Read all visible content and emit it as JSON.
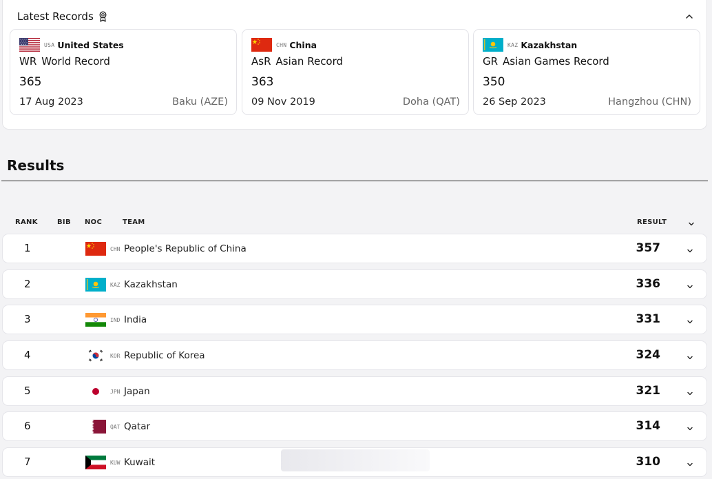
{
  "records": {
    "title": "Latest Records",
    "medal_icon": "medal-icon",
    "collapse_icon": "chevron-up-icon",
    "cards": [
      {
        "noc": "USA",
        "country": "United States",
        "abbr": "WR",
        "type": "World Record",
        "value": "365",
        "date": "17 Aug 2023",
        "venue": "Baku (AZE)",
        "flag": "usa"
      },
      {
        "noc": "CHN",
        "country": "China",
        "abbr": "AsR",
        "type": "Asian Record",
        "value": "363",
        "date": "09 Nov 2019",
        "venue": "Doha (QAT)",
        "flag": "chn"
      },
      {
        "noc": "KAZ",
        "country": "Kazakhstan",
        "abbr": "GR",
        "type": "Asian Games Record",
        "value": "350",
        "date": "26 Sep 2023",
        "venue": "Hangzhou (CHN)",
        "flag": "kaz"
      }
    ]
  },
  "results": {
    "title": "Results",
    "columns": {
      "rank": "RANK",
      "bib": "BIB",
      "noc": "NOC",
      "team": "TEAM",
      "result": "RESULT"
    },
    "rows": [
      {
        "rank": "1",
        "noc": "CHN",
        "team": "People's Republic of China",
        "result": "357",
        "flag": "chn"
      },
      {
        "rank": "2",
        "noc": "KAZ",
        "team": "Kazakhstan",
        "result": "336",
        "flag": "kaz"
      },
      {
        "rank": "3",
        "noc": "IND",
        "team": "India",
        "result": "331",
        "flag": "ind"
      },
      {
        "rank": "4",
        "noc": "KOR",
        "team": "Republic of Korea",
        "result": "324",
        "flag": "kor"
      },
      {
        "rank": "5",
        "noc": "JPN",
        "team": "Japan",
        "result": "321",
        "flag": "jpn"
      },
      {
        "rank": "6",
        "noc": "QAT",
        "team": "Qatar",
        "result": "314",
        "flag": "qat"
      },
      {
        "rank": "7",
        "noc": "KUW",
        "team": "Kuwait",
        "result": "310",
        "flag": "kuw"
      }
    ]
  },
  "colors": {
    "china_red": "#de2910",
    "kaz_blue": "#00afca",
    "gold": "#ffde00"
  }
}
